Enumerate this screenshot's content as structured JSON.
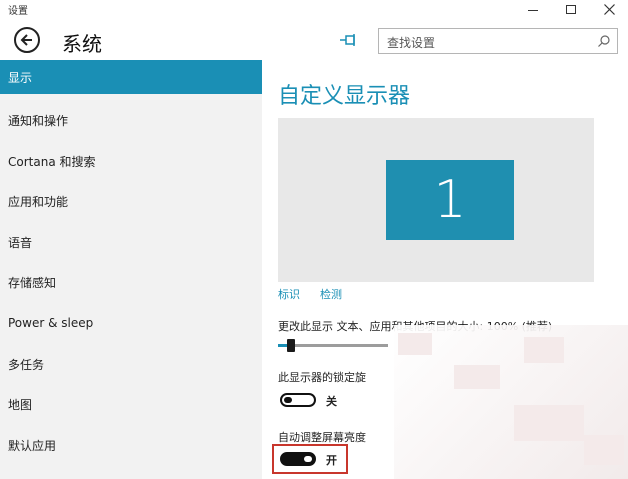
{
  "window": {
    "title": "设置",
    "controls": {
      "minimize": "minimize-icon",
      "maximize": "maximize-icon",
      "close": "close-icon"
    }
  },
  "header": {
    "back_icon": "back-arrow-icon",
    "title": "系统",
    "pin_icon": "pin-icon",
    "search_placeholder": "查找设置",
    "search_icon": "search-icon"
  },
  "sidebar": {
    "items": [
      {
        "label": "显示",
        "active": true
      },
      {
        "label": "通知和操作",
        "active": false
      },
      {
        "label": "Cortana 和搜索",
        "active": false
      },
      {
        "label": "应用和功能",
        "active": false
      },
      {
        "label": "语音",
        "active": false
      },
      {
        "label": "存储感知",
        "active": false
      },
      {
        "label": "Power & sleep",
        "active": false
      },
      {
        "label": "多任务",
        "active": false
      },
      {
        "label": "地图",
        "active": false
      },
      {
        "label": "默认应用",
        "active": false
      }
    ]
  },
  "content": {
    "title": "自定义显示器",
    "monitor_number": "1",
    "identify_link": "标识",
    "detect_link": "检测",
    "scale_label": "更改此显示 文本、应用和其他项目的大小: 100% (推荐)",
    "scale_level": 0.08,
    "lock_rotation_label": "此显示器的锁定旋",
    "lock_rotation_state": "关",
    "lock_rotation_on": false,
    "auto_brightness_label": "自动调整屏幕亮度",
    "auto_brightness_state": "开",
    "auto_brightness_on": true
  },
  "colors": {
    "accent": "#1a8fb5",
    "sidebar_bg": "#f2f2f2",
    "monitor": "#1f8fb0",
    "highlight": "#c8362c"
  }
}
